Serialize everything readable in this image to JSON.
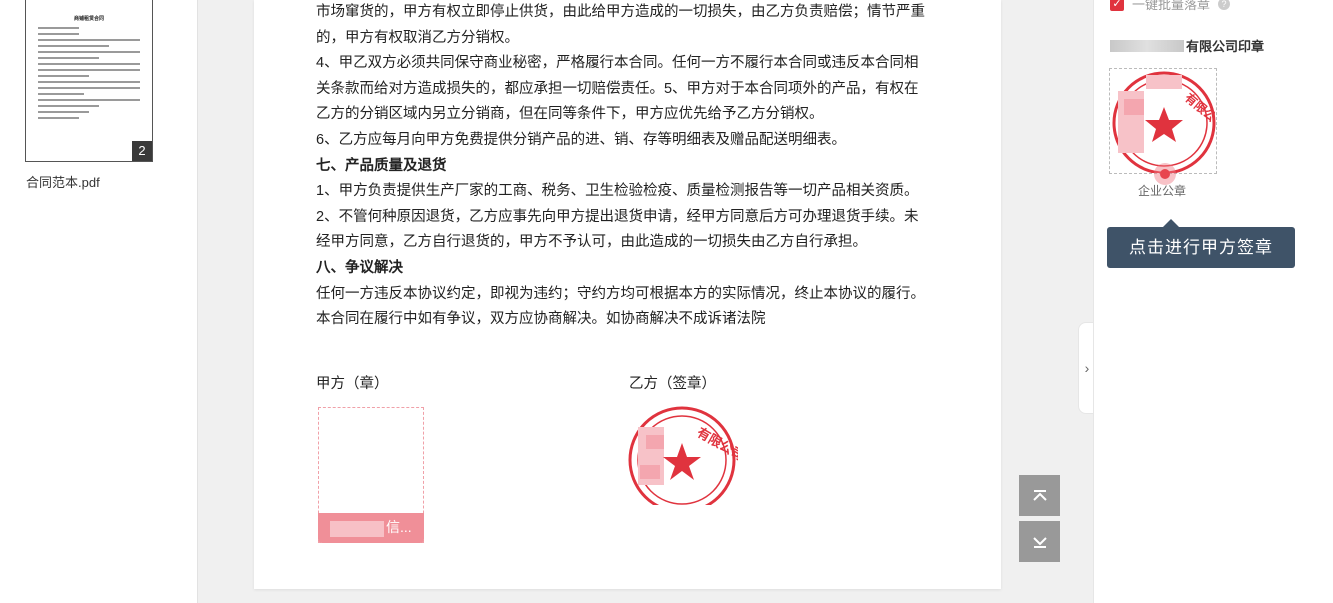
{
  "left_panel": {
    "thumbnail_title": "商铺租赁合同",
    "thumbnail_page_number": "2",
    "file_name": "合同范本.pdf"
  },
  "document": {
    "paragraphs": [
      {
        "text": "市场窜货的，甲方有权立即停止供货，由此给甲方造成的一切损失，由乙方负责赔偿；情节严重",
        "heading": false
      },
      {
        "text": "的，甲方有权取消乙方分销权。",
        "heading": false
      },
      {
        "text": "4、甲乙双方必须共同保守商业秘密，严格履行本合同。任何一方不履行本合同或违反本合同相",
        "heading": false
      },
      {
        "text": "关条款而给对方造成损失的，都应承担一切赔偿责任。5、甲方对于本合同项外的产品，有权在",
        "heading": false
      },
      {
        "text": "乙方的分销区域内另立分销商，但在同等条件下，甲方应优先给予乙方分销权。",
        "heading": false
      },
      {
        "text": "6、乙方应每月向甲方免费提供分销产品的进、销、存等明细表及赠品配送明细表。",
        "heading": false
      },
      {
        "text": "七、产品质量及退货",
        "heading": true
      },
      {
        "text": "1、甲方负责提供生产厂家的工商、税务、卫生检验检疫、质量检测报告等一切产品相关资质。",
        "heading": false
      },
      {
        "text": "2、不管何种原因退货，乙方应事先向甲方提出退货申请，经甲方同意后方可办理退货手续。未",
        "heading": false
      },
      {
        "text": "经甲方同意，乙方自行退货的，甲方不予认可，由此造成的一切损失由乙方自行承担。",
        "heading": false
      },
      {
        "text": "八、争议解决",
        "heading": true
      },
      {
        "text": "任何一方违反本协议约定，即视为违约；守约方均可根据本方的实际情况，终止本协议的履行。",
        "heading": false
      },
      {
        "text": "本合同在履行中如有争议，双方应协商解决。如协商解决不成诉诸法院",
        "heading": false
      }
    ],
    "party_a_label": "甲方（章）",
    "party_b_label": "乙方（签章）",
    "seal_placeholder_text": "信...",
    "stamp_b_text": "有限公司",
    "stamp_b_number": "3301101013862"
  },
  "right_panel": {
    "batch_seal_label": "一键批量落章",
    "batch_seal_checked": true,
    "company_seal_suffix": "有限公司印章",
    "seal_stamp_text": "有限公司",
    "seal_caption": "企业公章",
    "tooltip": "点击进行甲方签章"
  },
  "colors": {
    "seal_red": "#e0333e",
    "tooltip_bg": "#3f5368",
    "placeholder_pink": "#f08f98"
  },
  "icons": {
    "collapse": "chevron-right-icon",
    "scroll_top": "scroll-to-top-icon",
    "scroll_bottom": "scroll-to-bottom-icon",
    "help": "question-circle-icon"
  }
}
